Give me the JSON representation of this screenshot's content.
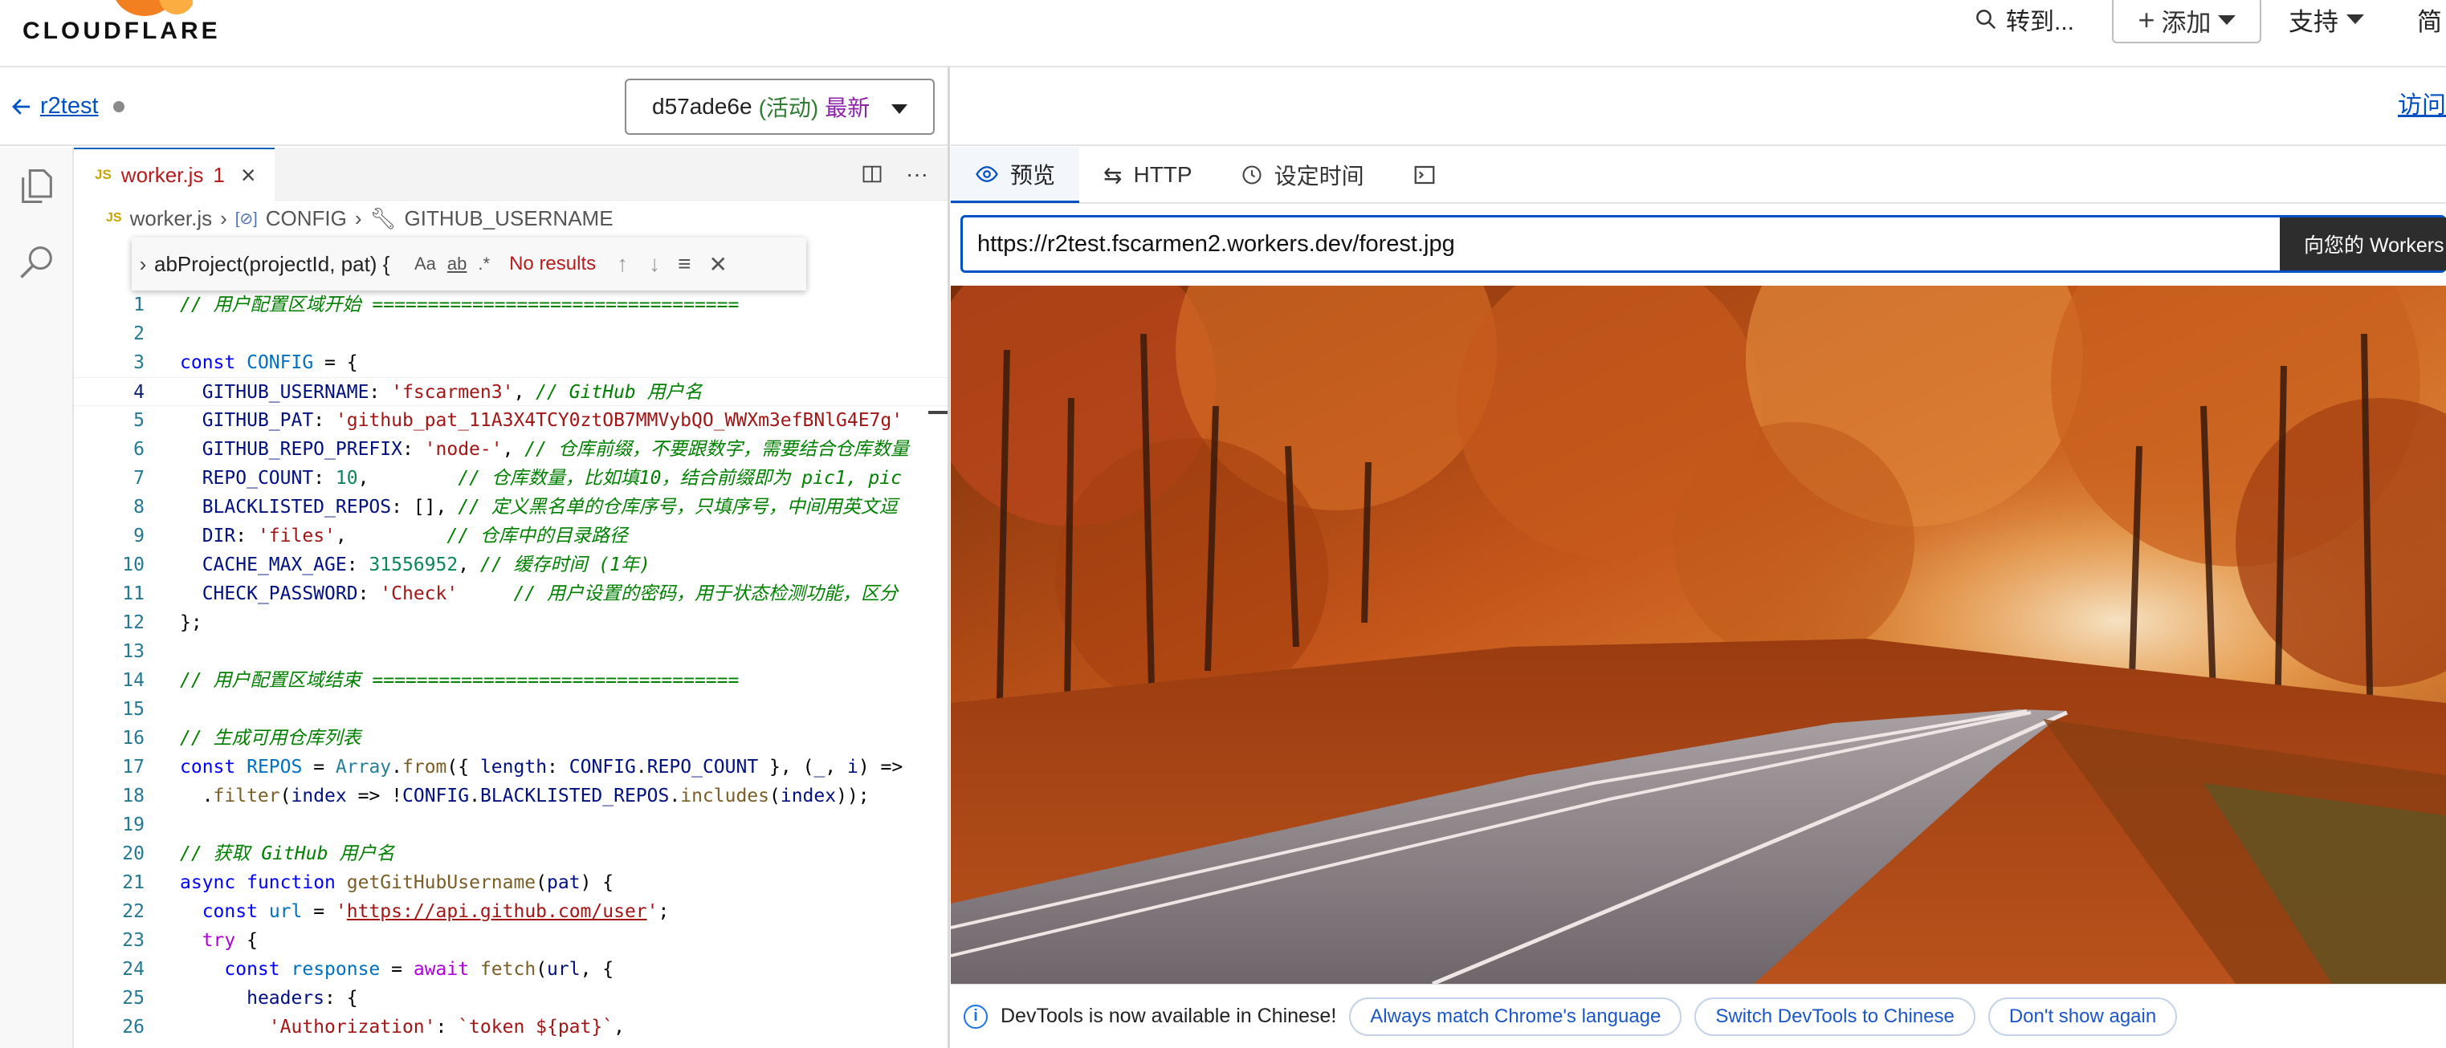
{
  "topbar": {
    "logo_text": "CLOUDFLARE",
    "search_label": "转到...",
    "add_label": "添加",
    "support_label": "支持",
    "lang_label": "简"
  },
  "subbar": {
    "worker_name": "r2test",
    "version_id": "d57ade6e",
    "version_active": "(活动)",
    "version_latest": "最新",
    "visit_label": "访问"
  },
  "editor": {
    "tab_filename": "worker.js",
    "tab_problems": "1",
    "breadcrumb": [
      "worker.js",
      "CONFIG",
      "GITHUB_USERNAME"
    ],
    "find_term": "abProject(projectId, pat) {",
    "find_opt_case": "Aa",
    "find_opt_word": "ab",
    "find_opt_regex": ".*",
    "find_result": "No results",
    "line_numbers": [
      "1",
      "2",
      "3",
      "4",
      "5",
      "6",
      "7",
      "8",
      "9",
      "10",
      "11",
      "12",
      "13",
      "14",
      "15",
      "16",
      "17",
      "18",
      "19",
      "20",
      "21",
      "22",
      "23",
      "24",
      "25",
      "26"
    ]
  },
  "preview": {
    "tabs": [
      "预览",
      "HTTP",
      "设定时间"
    ],
    "url": "https://r2test.fscarmen2.workers.dev/forest.jpg",
    "send_label": "向您的 Workers"
  },
  "devtools_bar": {
    "message": "DevTools is now available in Chinese!",
    "btn_match": "Always match Chrome's language",
    "btn_switch": "Switch DevTools to Chinese",
    "btn_dismiss": "Don't show again"
  },
  "colors": {
    "accent": "#0051c3",
    "brand_orange": "#f38020",
    "error_red": "#b71c1c"
  }
}
